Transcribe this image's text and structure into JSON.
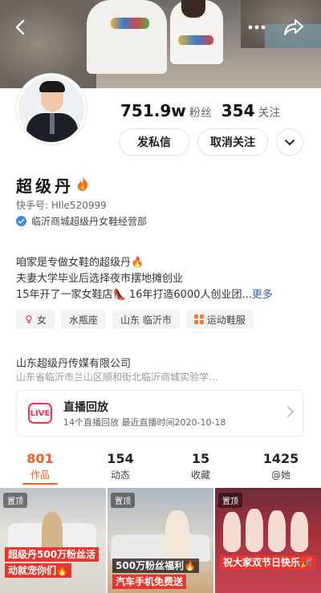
{
  "header": {
    "back_icon": "back-arrow-icon",
    "more_icon": "more-dots-icon",
    "share_icon": "share-icon"
  },
  "profile": {
    "fans_count": "751.9w",
    "fans_label": "粉丝",
    "following_count": "354",
    "following_label": "关注",
    "message_button": "发私信",
    "unfollow_button": "取消关注",
    "name": "超级丹",
    "kuaishou_id": "快手号: Hlle520999",
    "verified_text": "临沂商城超级丹女鞋经营部",
    "bio_lines": [
      "咱家是专做女鞋的超级丹🔥",
      "夫妻大学毕业后选择夜市摆地摊创业",
      "15年开了一家女鞋店👠 16年打造6000人创业团..."
    ],
    "bio_more": "更多",
    "tags": [
      {
        "icon": "female-icon",
        "label": "女"
      },
      {
        "icon": "",
        "label": "水瓶座"
      },
      {
        "icon": "",
        "label": "山东 临沂市"
      },
      {
        "icon": "sports-grid-icon",
        "label": "运动鞋服"
      }
    ],
    "company_name": "山东超级丹传媒有限公司",
    "company_address": "山东省临沂市兰山区顺和街北临沂商城实验学..."
  },
  "live": {
    "badge": "LIVE",
    "title": "直播回放",
    "subtitle": "14个直播回放 最近直播时间2020-10-18"
  },
  "tabs": [
    {
      "count": "801",
      "label": "作品"
    },
    {
      "count": "154",
      "label": "动态"
    },
    {
      "count": "15",
      "label": "收藏"
    },
    {
      "count": "1425",
      "label": "@她"
    }
  ],
  "videos": [
    {
      "pin": "置顶",
      "caption1": "超级丹500万粉丝活",
      "caption2": "动就宠你们🔥"
    },
    {
      "pin": "置顶",
      "caption1": "500万粉丝福利🔥",
      "caption2": "汽车手机免费送"
    },
    {
      "pin": "置顶",
      "caption1": "祝大家双节日快乐🎉",
      "caption2": ""
    }
  ],
  "colors": {
    "accent": "#fe5a1e",
    "live_red": "#fe2c55",
    "link_blue": "#2f5fb3"
  }
}
